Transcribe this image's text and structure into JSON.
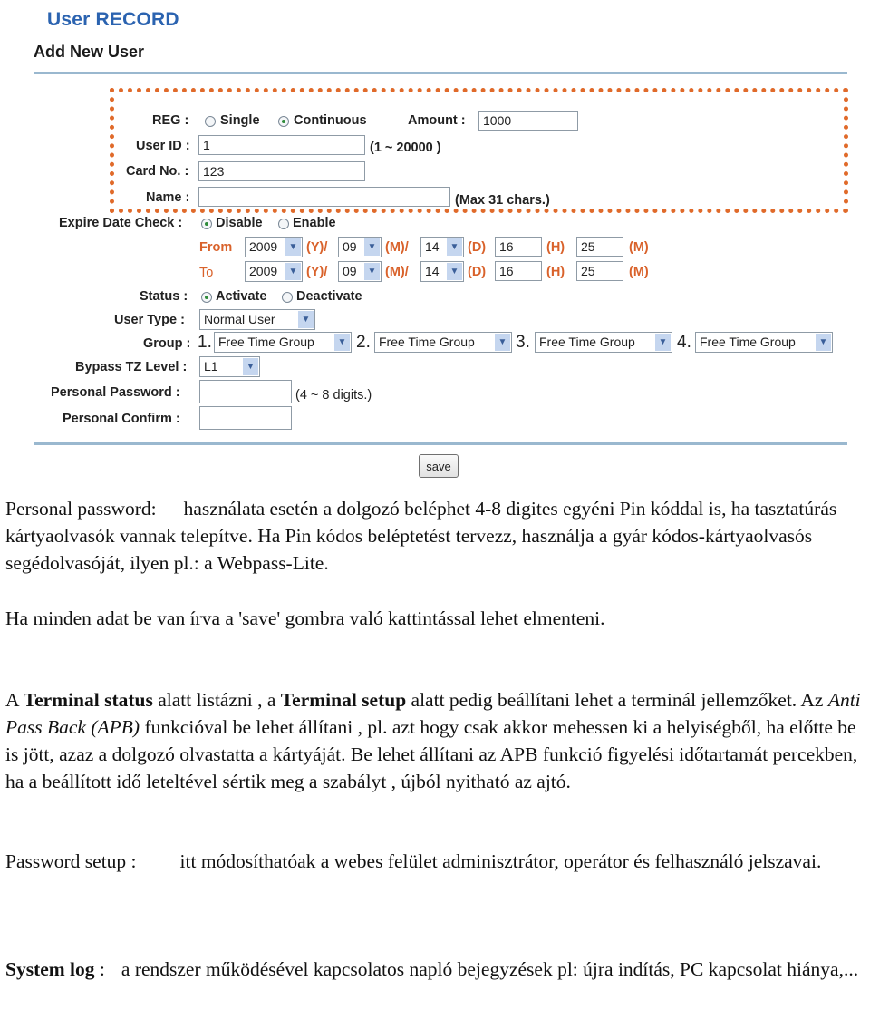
{
  "header": {
    "title": "User RECORD",
    "subtitle": "Add New User"
  },
  "form": {
    "reg": {
      "label": "REG :",
      "options": [
        "Single",
        "Continuous"
      ],
      "selected": "Continuous"
    },
    "amount": {
      "label": "Amount :",
      "value": "1000"
    },
    "user_id": {
      "label": "User ID :",
      "value": "1",
      "hint": "(1 ~ 20000 )"
    },
    "card_no": {
      "label": "Card No. :",
      "value": "123"
    },
    "name": {
      "label": "Name :",
      "value": "",
      "hint": "(Max 31 chars.)"
    },
    "expire_check": {
      "label": "Expire Date Check :",
      "options": [
        "Disable",
        "Enable"
      ],
      "selected": "Disable"
    },
    "from": {
      "label": "From",
      "year": "2009",
      "year_unit": "(Y)/",
      "month": "09",
      "month_unit": "(M)/",
      "day": "14",
      "day_unit": "(D)",
      "hour": "16",
      "hour_unit": "(H)",
      "minute": "25",
      "minute_unit": "(M)"
    },
    "to": {
      "label": "To",
      "year": "2009",
      "year_unit": "(Y)/",
      "month": "09",
      "month_unit": "(M)/",
      "day": "14",
      "day_unit": "(D)",
      "hour": "16",
      "hour_unit": "(H)",
      "minute": "25",
      "minute_unit": "(M)"
    },
    "status": {
      "label": "Status :",
      "options": [
        "Activate",
        "Deactivate"
      ],
      "selected": "Activate"
    },
    "user_type": {
      "label": "User Type :",
      "value": "Normal User"
    },
    "group": {
      "label": "Group :",
      "items": [
        {
          "num": "1.",
          "value": "Free Time Group"
        },
        {
          "num": "2.",
          "value": "Free Time Group"
        },
        {
          "num": "3.",
          "value": "Free Time Group"
        },
        {
          "num": "4.",
          "value": "Free Time Group"
        }
      ]
    },
    "bypass_tz": {
      "label": "Bypass TZ Level :",
      "value": "L1"
    },
    "personal_password": {
      "label": "Personal Password :",
      "value": "",
      "hint": "(4 ~ 8 digits.)"
    },
    "personal_confirm": {
      "label": "Personal Confirm :",
      "value": ""
    },
    "save_label": "save"
  },
  "colors": {
    "title": "#2b63b0",
    "highlight_border": "#e06a2a",
    "date_labels": "#d9622b",
    "divider": "#9ab8cf"
  },
  "document": {
    "p1_term": "Personal password:",
    "p1_text": "használata esetén a dolgozó beléphet 4-8 digites egyéni Pin kóddal is, ha tasztatúrás kártyaolvasók vannak telepítve. Ha Pin kódos beléptetést tervezz, használja a gyár kódos-kártyaolvasós segédolvasóját, ilyen pl.: a Webpass-Lite.",
    "p2_text": "Ha minden adat be van írva a 'save' gombra való kattintással lehet elmenteni.",
    "p3_a": "A ",
    "p3_b": "Terminal status",
    "p3_c": " alatt listázni , a ",
    "p3_d": "Terminal setup",
    "p3_e": " alatt pedig beállítani lehet a terminál jellemzőket. Az ",
    "p3_f": "Anti Pass Back (APB)",
    "p3_g": "  funkcióval be lehet állítani , pl. azt hogy csak akkor mehessen ki a helyiségből, ha előtte be is jött, azaz a dolgozó olvastatta a kártyáját. Be lehet állítani az APB funkció figyelési időtartamát percekben, ha a beállított idő leteltével sértik meg a szabályt , újból nyitható az ajtó.",
    "p4_term": "Password setup :",
    "p4_text": "itt módosíthatóak a webes felület adminisztrátor, operátor és felhasználó  jelszavai.",
    "p5_term": "System log",
    "p5_colon": " :",
    "p5_text": "a rendszer működésével kapcsolatos napló bejegyzések pl: újra indítás, PC kapcsolat hiánya,..."
  }
}
